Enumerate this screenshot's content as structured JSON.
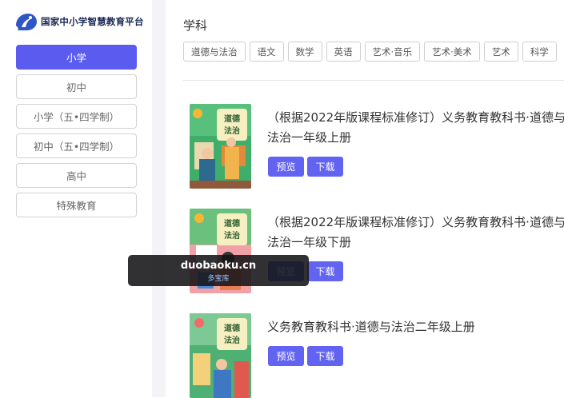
{
  "sidebar": {
    "logo_text": "国家中小学智慧教育平台",
    "items": [
      {
        "label": "小学",
        "active": true
      },
      {
        "label": "初中"
      },
      {
        "label": "小学（五•四学制）"
      },
      {
        "label": "初中（五•四学制）"
      },
      {
        "label": "高中"
      },
      {
        "label": "特殊教育"
      }
    ]
  },
  "main": {
    "subject_title": "学科",
    "subjects": [
      "道德与法治",
      "语文",
      "数学",
      "英语",
      "艺术·音乐",
      "艺术·美术",
      "艺术",
      "科学"
    ],
    "books": [
      {
        "title": "（根据2022年版课程标准修订）义务教育教科书·道德与法治一年级上册",
        "preview": "预览",
        "download": "下载",
        "cover_title": "道德与法治"
      },
      {
        "title": "（根据2022年版课程标准修订）义务教育教科书·道德与法治一年级下册",
        "preview": "预览",
        "download": "下载",
        "cover_title": "道德与法治"
      },
      {
        "title": "义务教育教科书·道德与法治二年级上册",
        "preview": "预览",
        "download": "下载",
        "cover_title": "道德与法治"
      }
    ]
  },
  "watermark": {
    "main": "duobaoku.cn",
    "sub": "多宝库"
  },
  "colors": {
    "accent": "#5b5bf0",
    "button": "#6363f2",
    "cover_green": "#3fae6a",
    "cover_sign": "#f6efc2"
  }
}
